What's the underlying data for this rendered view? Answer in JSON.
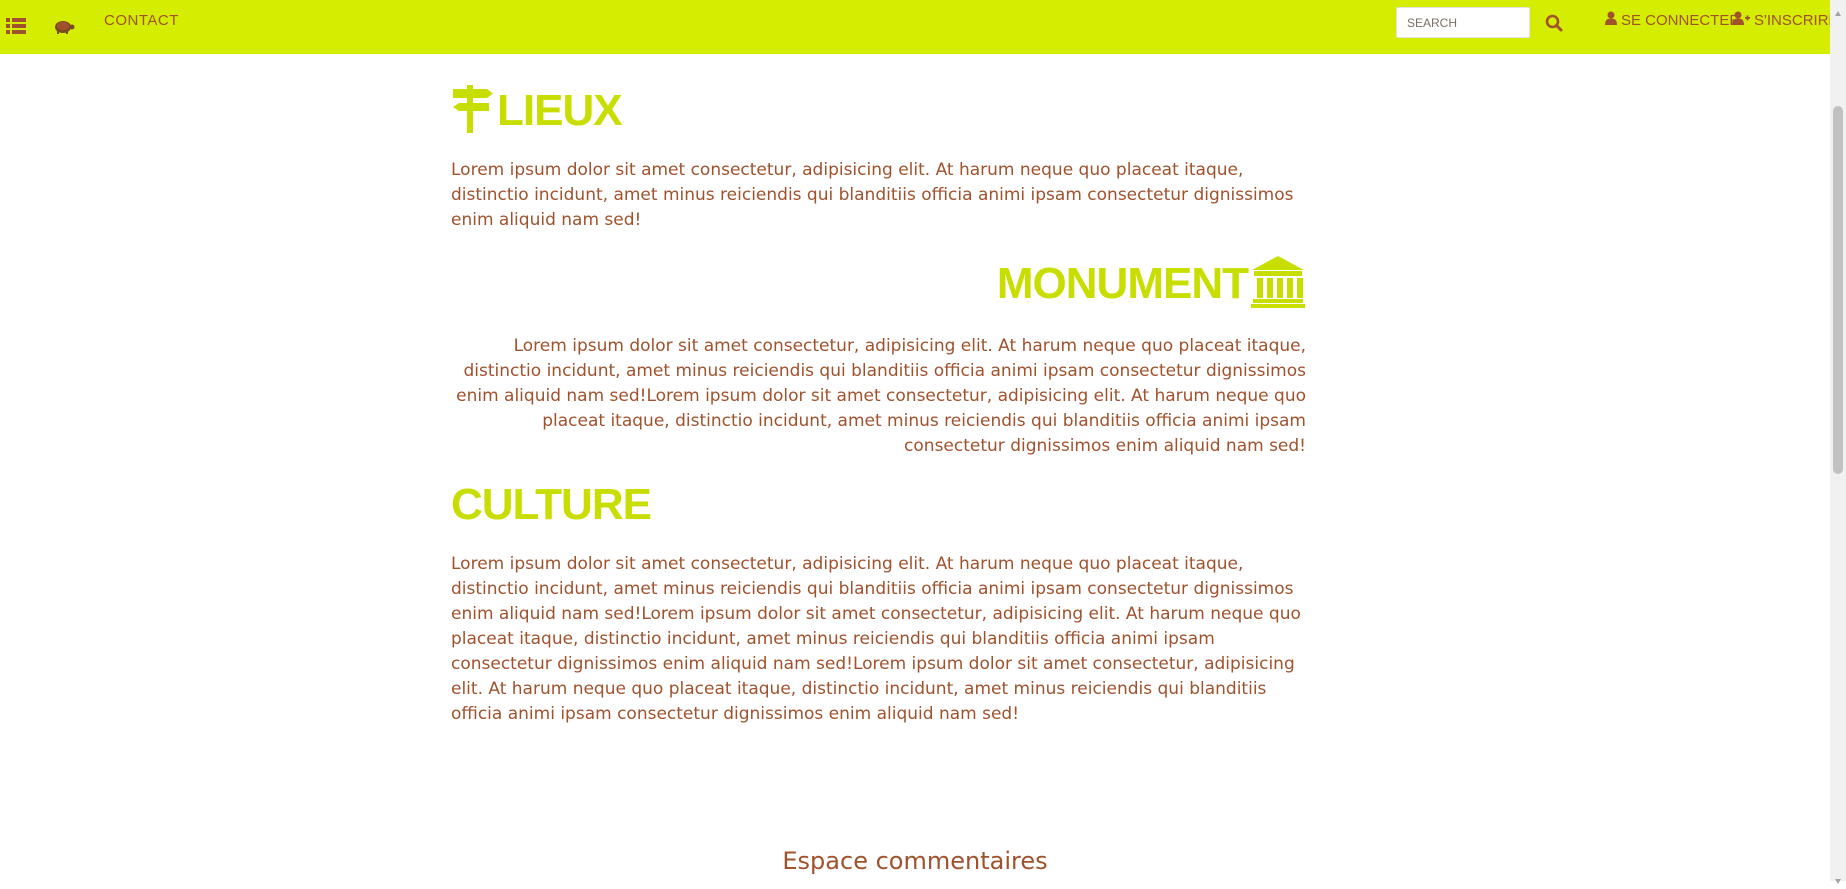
{
  "nav": {
    "menu_icon": "list-icon",
    "logo_icon": "turtle-logo-icon",
    "contact_label": "Contact",
    "search": {
      "placeholder": "SEARCH",
      "value": ""
    },
    "search_icon": "search-icon",
    "login_label": "Se connecter",
    "signup_label": "S'inscrire",
    "login_icon": "user-icon",
    "signup_icon": "user-plus-icon"
  },
  "sections": {
    "lieux": {
      "title": "Lieux",
      "icon": "signpost-icon",
      "text": "Lorem ipsum dolor sit amet consectetur, adipisicing elit. At harum neque quo placeat itaque, distinctio incidunt, amet minus reiciendis qui blanditiis officia animi ipsam consectetur dignissimos enim aliquid nam sed!"
    },
    "monument": {
      "title": "Monument",
      "icon": "bank-icon",
      "text": "Lorem ipsum dolor sit amet consectetur, adipisicing elit. At harum neque quo placeat itaque, distinctio incidunt, amet minus reiciendis qui blanditiis officia animi ipsam consectetur dignissimos enim aliquid nam sed!Lorem ipsum dolor sit amet consectetur, adipisicing elit. At harum neque quo placeat itaque, distinctio incidunt, amet minus reiciendis qui blanditiis officia animi ipsam consectetur dignissimos enim aliquid nam sed!"
    },
    "culture": {
      "title": "Culture",
      "text": "Lorem ipsum dolor sit amet consectetur, adipisicing elit. At harum neque quo placeat itaque, distinctio incidunt, amet minus reiciendis qui blanditiis officia animi ipsam consectetur dignissimos enim aliquid nam sed!Lorem ipsum dolor sit amet consectetur, adipisicing elit. At harum neque quo placeat itaque, distinctio incidunt, amet minus reiciendis qui blanditiis officia animi ipsam consectetur dignissimos enim aliquid nam sed!Lorem ipsum dolor sit amet consectetur, adipisicing elit. At harum neque quo placeat itaque, distinctio incidunt, amet minus reiciendis qui blanditiis officia animi ipsam consectetur dignissimos enim aliquid nam sed!"
    }
  },
  "comments": {
    "title": "Espace commentaires"
  },
  "colors": {
    "navbar_bg": "#d4ed00",
    "title_accent": "#c7de00",
    "text_brown": "#a0522d",
    "page_bg": "#ffffff"
  }
}
